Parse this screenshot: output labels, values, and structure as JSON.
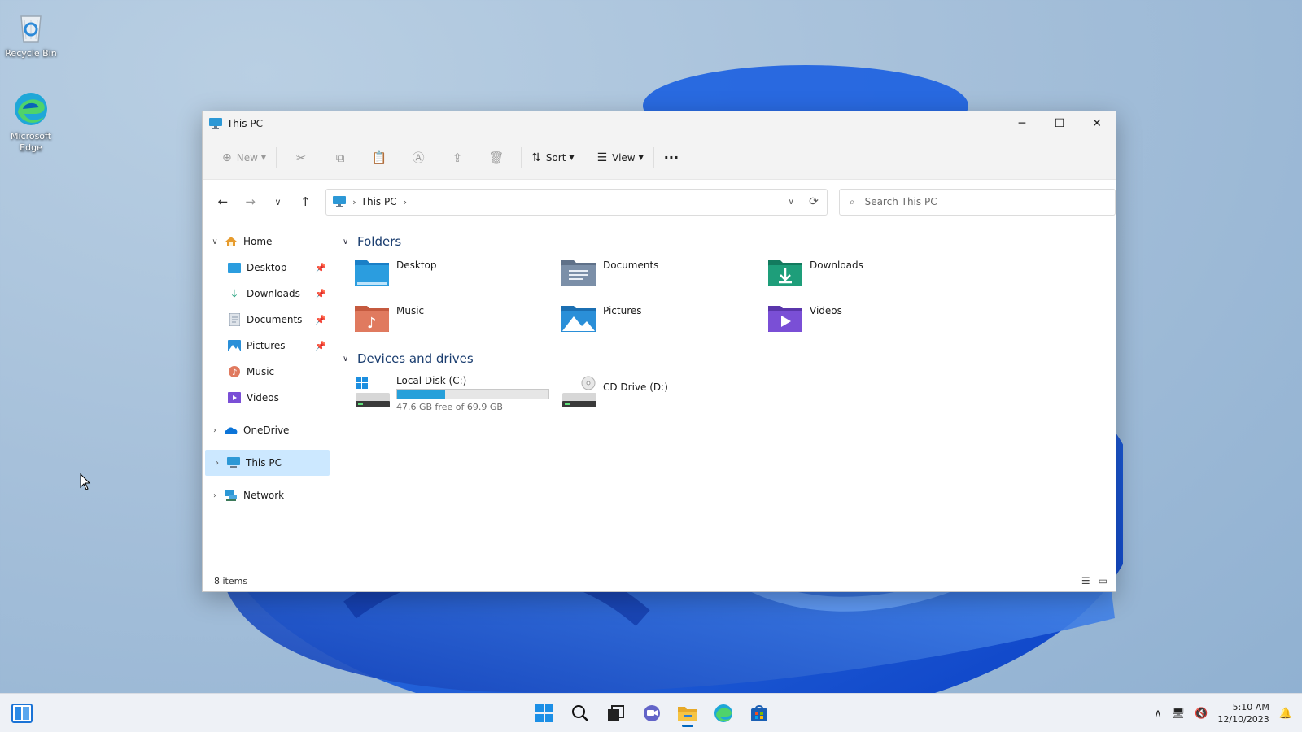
{
  "desktop": {
    "icons": [
      {
        "label": "Recycle Bin",
        "icon": "recycle-bin-icon"
      },
      {
        "label": "Microsoft Edge",
        "icon": "edge-icon"
      }
    ]
  },
  "window": {
    "title": "This PC",
    "controls": {
      "minimize": "─",
      "maximize": "☐",
      "close": "✕"
    }
  },
  "toolbar": {
    "new_label": "New",
    "sort_label": "Sort",
    "view_label": "View",
    "more_label": "···"
  },
  "address": {
    "crumbs": [
      "This PC"
    ],
    "search_placeholder": "Search This PC"
  },
  "sidebar": {
    "home": "Home",
    "quick_access": [
      {
        "label": "Desktop",
        "pinned": true,
        "icon": "desktop-folder-icon"
      },
      {
        "label": "Downloads",
        "pinned": true,
        "icon": "downloads-icon"
      },
      {
        "label": "Documents",
        "pinned": true,
        "icon": "documents-icon"
      },
      {
        "label": "Pictures",
        "pinned": true,
        "icon": "pictures-icon"
      },
      {
        "label": "Music",
        "pinned": false,
        "icon": "music-icon"
      },
      {
        "label": "Videos",
        "pinned": false,
        "icon": "videos-icon"
      }
    ],
    "onedrive": "OneDrive",
    "this_pc": "This PC",
    "network": "Network"
  },
  "content": {
    "folders_header": "Folders",
    "folders": [
      {
        "label": "Desktop",
        "icon": "desktop-folder-icon",
        "color": "#2b9ddf"
      },
      {
        "label": "Documents",
        "icon": "documents-folder-icon",
        "color": "#7b8fa8"
      },
      {
        "label": "Downloads",
        "icon": "downloads-folder-icon",
        "color": "#1e9e7a"
      },
      {
        "label": "Music",
        "icon": "music-folder-icon",
        "color": "#e07a5f"
      },
      {
        "label": "Pictures",
        "icon": "pictures-folder-icon",
        "color": "#2a8fd8"
      },
      {
        "label": "Videos",
        "icon": "videos-folder-icon",
        "color": "#7a4fd6"
      }
    ],
    "drives_header": "Devices and drives",
    "drives": [
      {
        "label": "Local Disk (C:)",
        "free_text": "47.6 GB free of 69.9 GB",
        "used_fraction": 0.319,
        "icon": "local-disk-icon"
      },
      {
        "label": "CD Drive (D:)",
        "icon": "cd-drive-icon"
      }
    ]
  },
  "status": {
    "items_text": "8 items"
  },
  "taskbar": {
    "apps": [
      "start-icon",
      "search-icon",
      "task-view-icon",
      "chat-icon",
      "file-explorer-icon",
      "edge-icon",
      "store-icon"
    ],
    "time": "5:10 AM",
    "date": "12/10/2023"
  },
  "colors": {
    "accent": "#0067c0",
    "selection": "#cce8ff",
    "progress": "#26a0da"
  }
}
